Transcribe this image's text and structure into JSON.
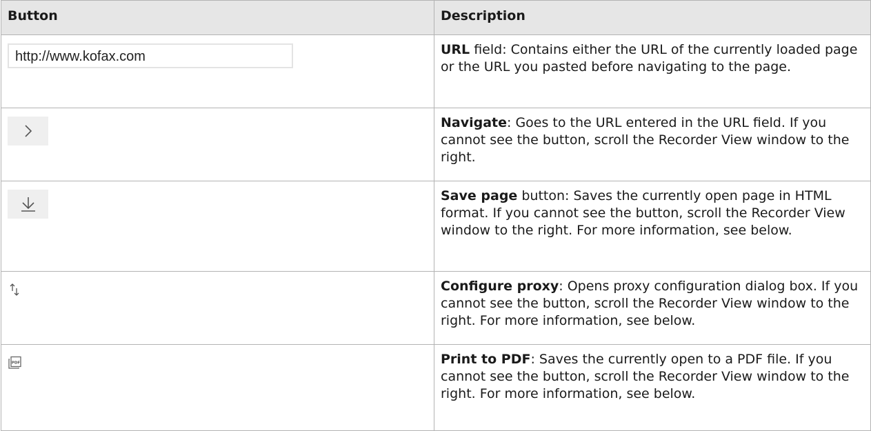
{
  "headers": {
    "button": "Button",
    "description": "Description"
  },
  "rows": [
    {
      "icon": "url-field",
      "url_value": "http://www.kofax.com",
      "term": "URL",
      "text": " field: Contains either the URL of the currently loaded page or the URL you pasted before navigating to the page."
    },
    {
      "icon": "chevron-right-icon",
      "term": "Navigate",
      "text": ": Goes to the URL entered in the URL field. If you cannot see the button, scroll the Recorder View window to the right."
    },
    {
      "icon": "download-icon",
      "term": "Save page",
      "text": " button: Saves the currently open page in HTML format. If you cannot see the button, scroll the Recorder View window to the right. For more information, see below."
    },
    {
      "icon": "proxy-arrows-icon",
      "term": "Configure proxy",
      "text": ": Opens proxy configuration dialog box. If you cannot see the button, scroll the Recorder View window to the right. For more information, see below."
    },
    {
      "icon": "pdf-icon",
      "icon_label": "PDF",
      "term": "Print to PDF",
      "text": ": Saves the currently open to a PDF file. If you cannot see the button, scroll the Recorder View window to the right. For more information, see below."
    }
  ],
  "colors": {
    "header_bg": "#e6e6e6",
    "border": "#b3b3b3",
    "button_bg": "#efefef"
  }
}
